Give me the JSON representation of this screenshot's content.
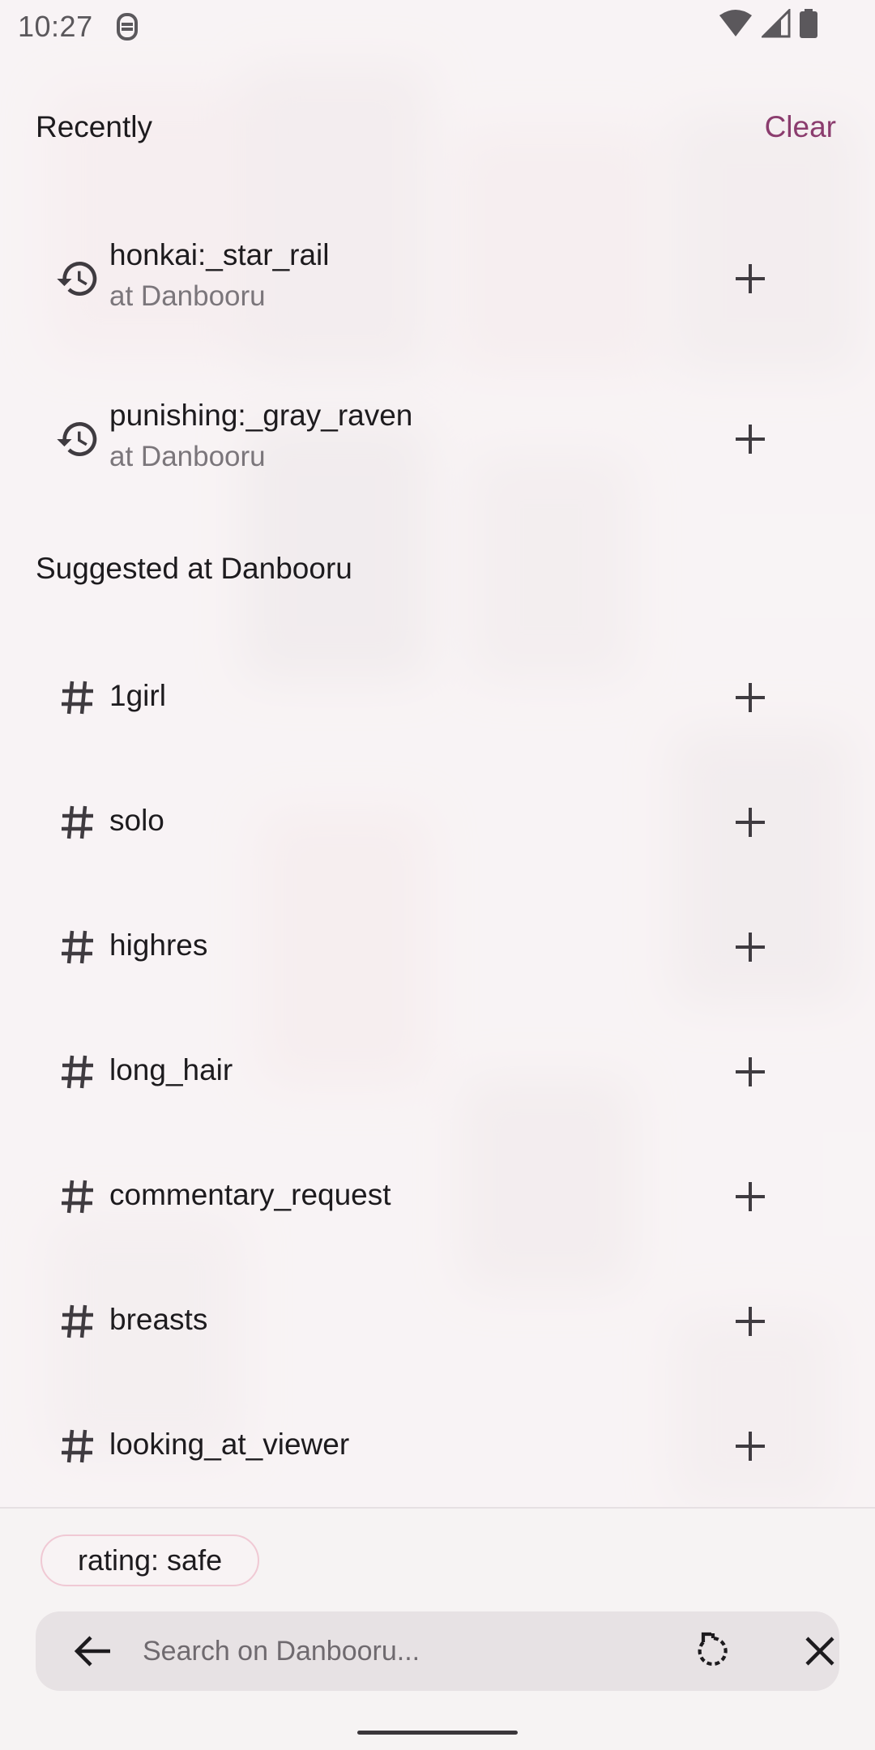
{
  "status_bar": {
    "time": "10:27"
  },
  "recently": {
    "title": "Recently",
    "clear_label": "Clear",
    "items": [
      {
        "tag": "honkai:_star_rail",
        "source": "at Danbooru"
      },
      {
        "tag": "punishing:_gray_raven",
        "source": "at Danbooru"
      }
    ]
  },
  "suggested": {
    "title": "Suggested at Danbooru",
    "items": [
      {
        "tag": "1girl"
      },
      {
        "tag": "solo"
      },
      {
        "tag": "highres"
      },
      {
        "tag": "long_hair"
      },
      {
        "tag": "commentary_request"
      },
      {
        "tag": "breasts"
      },
      {
        "tag": "looking_at_viewer"
      }
    ]
  },
  "filter_chip": {
    "label": "rating: safe"
  },
  "search": {
    "placeholder": "Search on Danbooru...",
    "value": ""
  },
  "colors": {
    "accent": "#8b3c6e",
    "chip_border": "#f0c9d4",
    "search_bg": "#e7e2e4"
  }
}
